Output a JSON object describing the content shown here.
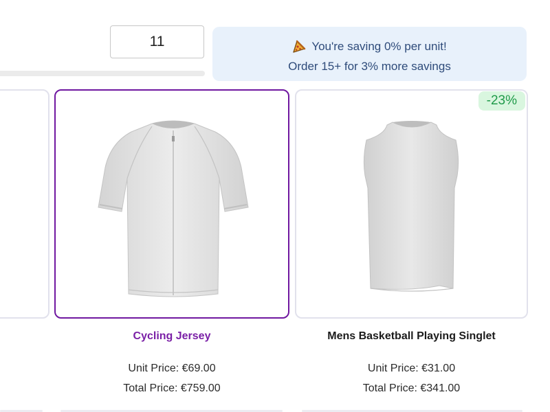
{
  "quantity": {
    "value": "11"
  },
  "savings": {
    "message": "You're saving 0% per unit!",
    "next_tier": "Order 15+ for 3% more savings",
    "icon": "pizza-icon"
  },
  "products": [
    {
      "name": "Cycling Jersey",
      "selected": true,
      "unit_price": "Unit Price: €69.00",
      "total_price": "Total Price: €759.00",
      "image_icon": "cycling-jersey-image"
    },
    {
      "name": "Mens Basketball Playing Singlet",
      "selected": false,
      "badge": "-23%",
      "unit_price": "Unit Price: €31.00",
      "total_price": "Total Price: €341.00",
      "image_icon": "basketball-singlet-image"
    }
  ],
  "colors": {
    "selected_border": "#6f17a0",
    "selected_name": "#7a1fa6",
    "badge_bg": "#d9f6df",
    "badge_text": "#1f9a49",
    "savings_bg": "#e8f1fb",
    "savings_text": "#2e4b7a"
  }
}
